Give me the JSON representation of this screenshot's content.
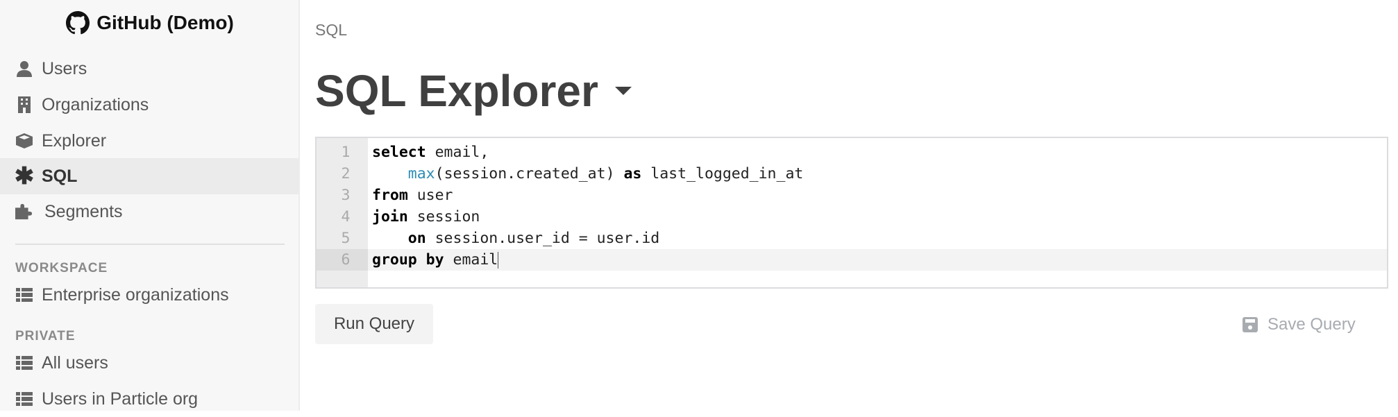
{
  "sidebar": {
    "brand": "GitHub (Demo)",
    "items": [
      {
        "label": "Users",
        "icon": "user-icon"
      },
      {
        "label": "Organizations",
        "icon": "building-icon"
      },
      {
        "label": "Explorer",
        "icon": "cube-icon"
      },
      {
        "label": "SQL",
        "icon": "asterisk-icon",
        "active": true
      },
      {
        "label": "Segments",
        "icon": "puzzle-icon"
      }
    ],
    "workspace": {
      "heading": "WORKSPACE",
      "items": [
        {
          "label": "Enterprise organizations",
          "icon": "table-list-icon"
        }
      ]
    },
    "private": {
      "heading": "PRIVATE",
      "items": [
        {
          "label": "All users",
          "icon": "table-list-icon"
        },
        {
          "label": "Users in Particle org",
          "icon": "table-list-icon"
        }
      ]
    }
  },
  "main": {
    "breadcrumb": "SQL",
    "title": "SQL Explorer",
    "editor": {
      "line_numbers": [
        "1",
        "2",
        "3",
        "4",
        "5",
        "6"
      ],
      "active_line": 6,
      "lines": [
        [
          {
            "t": "select",
            "k": "kw"
          },
          {
            "t": " email,"
          }
        ],
        [
          {
            "t": "    "
          },
          {
            "t": "max",
            "k": "fn"
          },
          {
            "t": "(session.created_at) "
          },
          {
            "t": "as",
            "k": "kw"
          },
          {
            "t": " last_logged_in_at"
          }
        ],
        [
          {
            "t": "from",
            "k": "kw"
          },
          {
            "t": " user"
          }
        ],
        [
          {
            "t": "join",
            "k": "kw"
          },
          {
            "t": " session"
          }
        ],
        [
          {
            "t": "    "
          },
          {
            "t": "on",
            "k": "kw"
          },
          {
            "t": " session.user_id = user.id"
          }
        ],
        [
          {
            "t": "group by",
            "k": "kw"
          },
          {
            "t": " email"
          }
        ]
      ]
    },
    "run_label": "Run Query",
    "save_label": "Save Query"
  },
  "colors": {
    "keyword": "#000000",
    "function": "#2d8cb5",
    "disabled": "#a8abb0"
  }
}
